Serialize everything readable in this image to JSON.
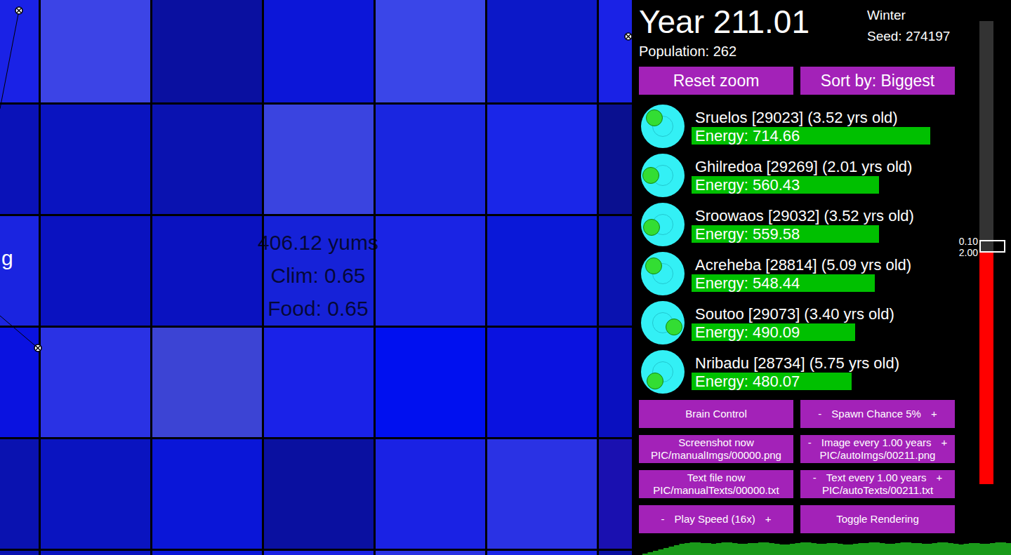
{
  "world": {
    "tiles": [
      {
        "color": "#1a22e6"
      },
      {
        "color": "#3c44e6"
      },
      {
        "color": "#0a10a0"
      },
      {
        "color": "#0c16d8"
      },
      {
        "color": "#3a46e8"
      },
      {
        "color": "#0c18c8"
      },
      {
        "color": "#1a22e6"
      },
      {
        "color": "#0a12b8"
      },
      {
        "color": "#0a14c0"
      },
      {
        "color": "#0a12b0"
      },
      {
        "color": "#3a44e0"
      },
      {
        "color": "#1a26e0"
      },
      {
        "color": "#1a26e8"
      },
      {
        "color": "#0a1090"
      },
      {
        "color": "#1a24e0"
      },
      {
        "color": "#0a12c0"
      },
      {
        "color": "#0a12c0"
      },
      {
        "color": "#1622d8"
      },
      {
        "color": "#1a24e4"
      },
      {
        "color": "#0a18d8"
      },
      {
        "color": "#0a12b0"
      },
      {
        "color": "#0a12e0"
      },
      {
        "color": "#2a32e4"
      },
      {
        "color": "#3c44d4"
      },
      {
        "color": "#1a22e8"
      },
      {
        "color": "#0010f0"
      },
      {
        "color": "#0a12e0"
      },
      {
        "color": "#0a10c0"
      },
      {
        "color": "#0a12b0"
      },
      {
        "color": "#0a14c0"
      },
      {
        "color": "#0a16d8"
      },
      {
        "color": "#0a10a0"
      },
      {
        "color": "#1a22e4"
      },
      {
        "color": "#2a32e4"
      },
      {
        "color": "#1a10b0"
      },
      {
        "color": "#0a12b0"
      },
      {
        "color": "#0a14c0"
      },
      {
        "color": "#0a16d8"
      },
      {
        "color": "#1a22e4"
      },
      {
        "color": "#2a32e4"
      },
      {
        "color": "#1a26e8"
      },
      {
        "color": "#0a10a0"
      }
    ],
    "tile_info": [
      "406.12 yums",
      "Clim: 0.65",
      "Food: 0.65"
    ],
    "cut_label": "g"
  },
  "panel": {
    "year": "Year 211.01",
    "population": "Population: 262",
    "season": "Winter",
    "seed": "Seed: 274197",
    "top_buttons": [
      "Reset zoom",
      "Sort by: Biggest"
    ],
    "creatures": [
      {
        "name": "Sruelos [29023] (3.52 yrs old)",
        "energy": "Energy: 714.66",
        "level": 0.944,
        "eye_angle": 225
      },
      {
        "name": "Ghilredoa [29269] (2.01 yrs old)",
        "energy": "Energy: 560.43",
        "level": 0.742,
        "eye_angle": 180
      },
      {
        "name": "Sroowaos [29032] (3.52 yrs old)",
        "energy": "Energy: 559.58",
        "level": 0.742,
        "eye_angle": 165
      },
      {
        "name": "Acreheba [28814] (5.09 yrs old)",
        "energy": "Energy: 548.44",
        "level": 0.725,
        "eye_angle": 220
      },
      {
        "name": "Soutoo [29073] (3.40 yrs old)",
        "energy": "Energy: 490.09",
        "level": 0.647,
        "eye_angle": 20
      },
      {
        "name": "Nribadu [28734] (5.75 yrs old)",
        "energy": "Energy: 480.07",
        "level": 0.633,
        "eye_angle": 130
      }
    ],
    "controls": [
      {
        "minus": "",
        "label": "Brain Control",
        "plus": "",
        "path": ""
      },
      {
        "minus": "-",
        "label": "Spawn Chance 5%",
        "plus": "+",
        "path": ""
      },
      {
        "minus": "",
        "label": "Screenshot now",
        "plus": "",
        "path": "PIC/manualImgs/00000.png"
      },
      {
        "minus": "-",
        "label": "Image every 1.00 years",
        "plus": "+",
        "path": "PIC/autoImgs/00211.png"
      },
      {
        "minus": "",
        "label": "Text file now",
        "plus": "",
        "path": "PIC/manualTexts/00000.txt"
      },
      {
        "minus": "-",
        "label": "Text every 1.00 years",
        "plus": "+",
        "path": "PIC/autoTexts/00211.txt"
      },
      {
        "minus": "-",
        "label": "Play Speed (16x)",
        "plus": "+",
        "path": ""
      },
      {
        "minus": "",
        "label": "Toggle Rendering",
        "plus": "",
        "path": ""
      }
    ],
    "speed_slider": {
      "level": 0.5,
      "labels": [
        "0.10",
        "2.00"
      ]
    },
    "population_chart": {
      "values": [
        2,
        4,
        6,
        8,
        10,
        12,
        14,
        16,
        17,
        18,
        18,
        17,
        17,
        16,
        17,
        18,
        18,
        17,
        16,
        16,
        17,
        17,
        18,
        18,
        17,
        16,
        15,
        15,
        16,
        17,
        18,
        18,
        17,
        16,
        16,
        17,
        17,
        16,
        15,
        15,
        16,
        17,
        17,
        18,
        18,
        17,
        16,
        16,
        17,
        18,
        18,
        17,
        17,
        16,
        16,
        17,
        18,
        18,
        17,
        16,
        15,
        16,
        17,
        17,
        16,
        16,
        17,
        18,
        18,
        17
      ]
    }
  }
}
